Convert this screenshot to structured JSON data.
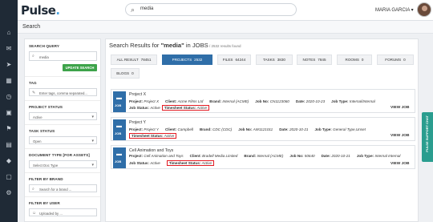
{
  "brand": {
    "logo": "Pulse"
  },
  "search": {
    "value": "media"
  },
  "user": {
    "name": "MARIA GARCIA"
  },
  "page": {
    "title": "Search"
  },
  "filters": {
    "search_query_label": "SEARCH QUERY",
    "search_query_value": "media",
    "update_button": "UPDATE SEARCH",
    "tag_label": "TAG",
    "tag_placeholder": "Enter tags, comma separated...",
    "project_status_label": "PROJECT STATUS",
    "project_status_value": "Active",
    "task_status_label": "TASK STATUS",
    "task_status_value": "Open",
    "doc_type_label": "DOCUMENT TYPE [FOR ASSETS]",
    "doc_type_placeholder": "Select Doc Type",
    "brand_label": "FILTER BY BRAND",
    "brand_placeholder": "Search for a brand ...",
    "user_label": "FILTER BY USER",
    "user_placeholder": "Uploaded by ..."
  },
  "results": {
    "title_prefix": "Search Results for ",
    "query": "\"media\"",
    "in": " in JOBS",
    "count": " / 2532 results found"
  },
  "tabs": [
    {
      "label": "ALL RESULT",
      "count": "78451"
    },
    {
      "label": "PROJECTS",
      "count": "2532"
    },
    {
      "label": "FILES",
      "count": "64244"
    },
    {
      "label": "TASKS",
      "count": "3830"
    },
    {
      "label": "NOTES",
      "count": "7845"
    },
    {
      "label": "ROOMS",
      "count": "0"
    },
    {
      "label": "FORUMS",
      "count": "0"
    },
    {
      "label": "BLOGS",
      "count": "0"
    }
  ],
  "cards": [
    {
      "icon_label": "JOB",
      "title": "Project X",
      "project_label": "Project:",
      "project": "Project X",
      "client_label": "Client:",
      "client": "Acme Films Ltd",
      "brand_label": "Brand:",
      "brand": "Internal (ACME)",
      "jobno_label": "Job No:",
      "jobno": "CN1123060",
      "date_label": "Date:",
      "date": "2020-10-23",
      "jobtype_label": "Job Type:",
      "jobtype": "Internal/Internal",
      "jobstatus_label": "Job Status:",
      "jobstatus": "Active",
      "timesheet_label": "Timesheet Status:",
      "timesheet": "Active",
      "view": "VIEW JOB"
    },
    {
      "icon_label": "JOB",
      "title": "Project Y",
      "project_label": "Project:",
      "project": "Project Y",
      "client_label": "Client:",
      "client": "Campbell",
      "brand_label": "Brand:",
      "brand": "CDC (CDC)",
      "jobno_label": "Job No:",
      "jobno": "AW1121011",
      "date_label": "Date:",
      "date": "2020-10-21",
      "jobtype_label": "Job Type:",
      "jobtype": "General Type,Unset",
      "jobstatus_label": "Job Status:",
      "jobstatus": "Active",
      "timesheet_label": "Timesheet Status:",
      "timesheet": "Active",
      "view": "VIEW JOB"
    },
    {
      "icon_label": "JOB",
      "title": "Cell Animation and Toys",
      "project_label": "Project:",
      "project": "Cell Animation and Toys",
      "client_label": "Client:",
      "client": "Bradell Media Limited",
      "brand_label": "Brand:",
      "brand": "Internal (ACME)",
      "jobno_label": "Job No:",
      "jobno": "50640",
      "date_label": "Date:",
      "date": "2020-10-21",
      "jobtype_label": "Job Type:",
      "jobtype": "Internal Internal",
      "jobstatus_label": "Job Status:",
      "jobstatus": "Active",
      "timesheet_label": "Timesheet Status:",
      "timesheet": "Active",
      "view": "VIEW JOB"
    }
  ],
  "support": {
    "label": "PULSE SUPPORT CHAT"
  }
}
